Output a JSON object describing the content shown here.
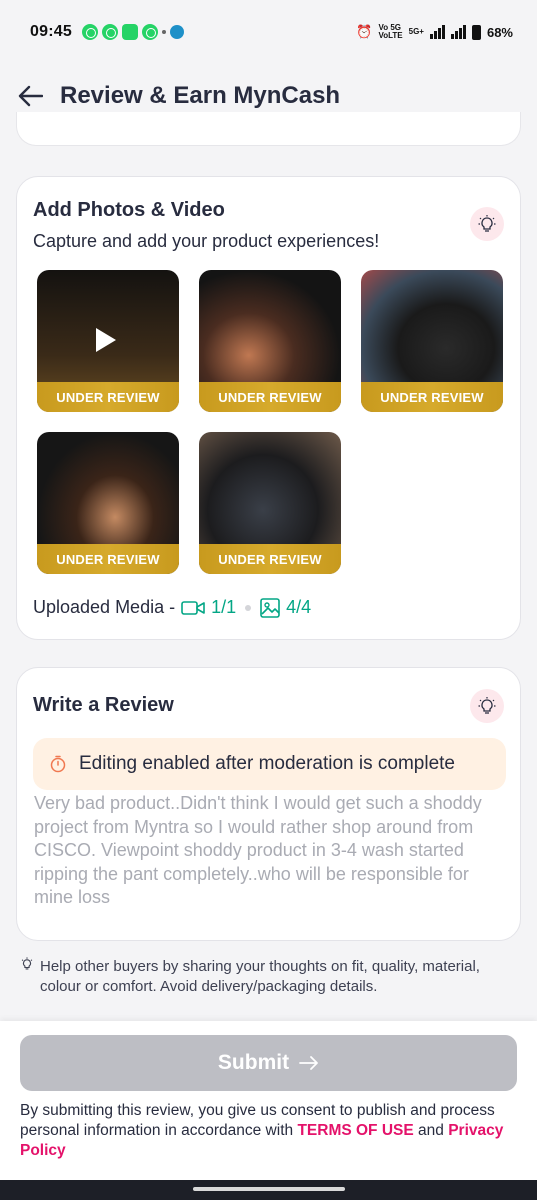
{
  "status_bar": {
    "time": "09:45",
    "network_top": "Vo 5G",
    "network_bottom": "VoLTE",
    "tech": "5G+",
    "battery": "68%"
  },
  "header": {
    "title": "Review & Earn MynCash",
    "back_icon": "arrow-left-icon"
  },
  "media_section": {
    "title": "Add Photos & Video",
    "subtitle": "Capture and add your product experiences!",
    "items": [
      {
        "type": "video",
        "status": "UNDER REVIEW"
      },
      {
        "type": "photo",
        "status": "UNDER REVIEW"
      },
      {
        "type": "photo",
        "status": "UNDER REVIEW"
      },
      {
        "type": "photo",
        "status": "UNDER REVIEW"
      },
      {
        "type": "photo",
        "status": "UNDER REVIEW"
      }
    ],
    "uploaded_label": "Uploaded Media -",
    "video_count": "1/1",
    "photo_count": "4/4"
  },
  "review_section": {
    "title": "Write a Review",
    "notice": "Editing enabled after moderation is complete",
    "review_text": "Very bad product..Didn't think I would get such a shoddy project from Myntra so I would rather shop around from CISCO. Viewpoint shoddy product in 3-4 wash started ripping the pant completely..who will be responsible for mine loss"
  },
  "hint": "Help other buyers by sharing your thoughts on fit, quality, material, colour or comfort. Avoid delivery/packaging details.",
  "footer": {
    "submit_label": "Submit",
    "consent_prefix": "By submitting this review, you give us consent to publish and process personal information in accordance with",
    "terms_label": "TERMS OF USE",
    "and_label": "and",
    "privacy_label": "Privacy Policy"
  },
  "colors": {
    "accent_pink": "#e4126a",
    "success_green": "#03a685",
    "ribbon_gold": "#d6aa2c",
    "disabled_button": "#bdbec4"
  }
}
